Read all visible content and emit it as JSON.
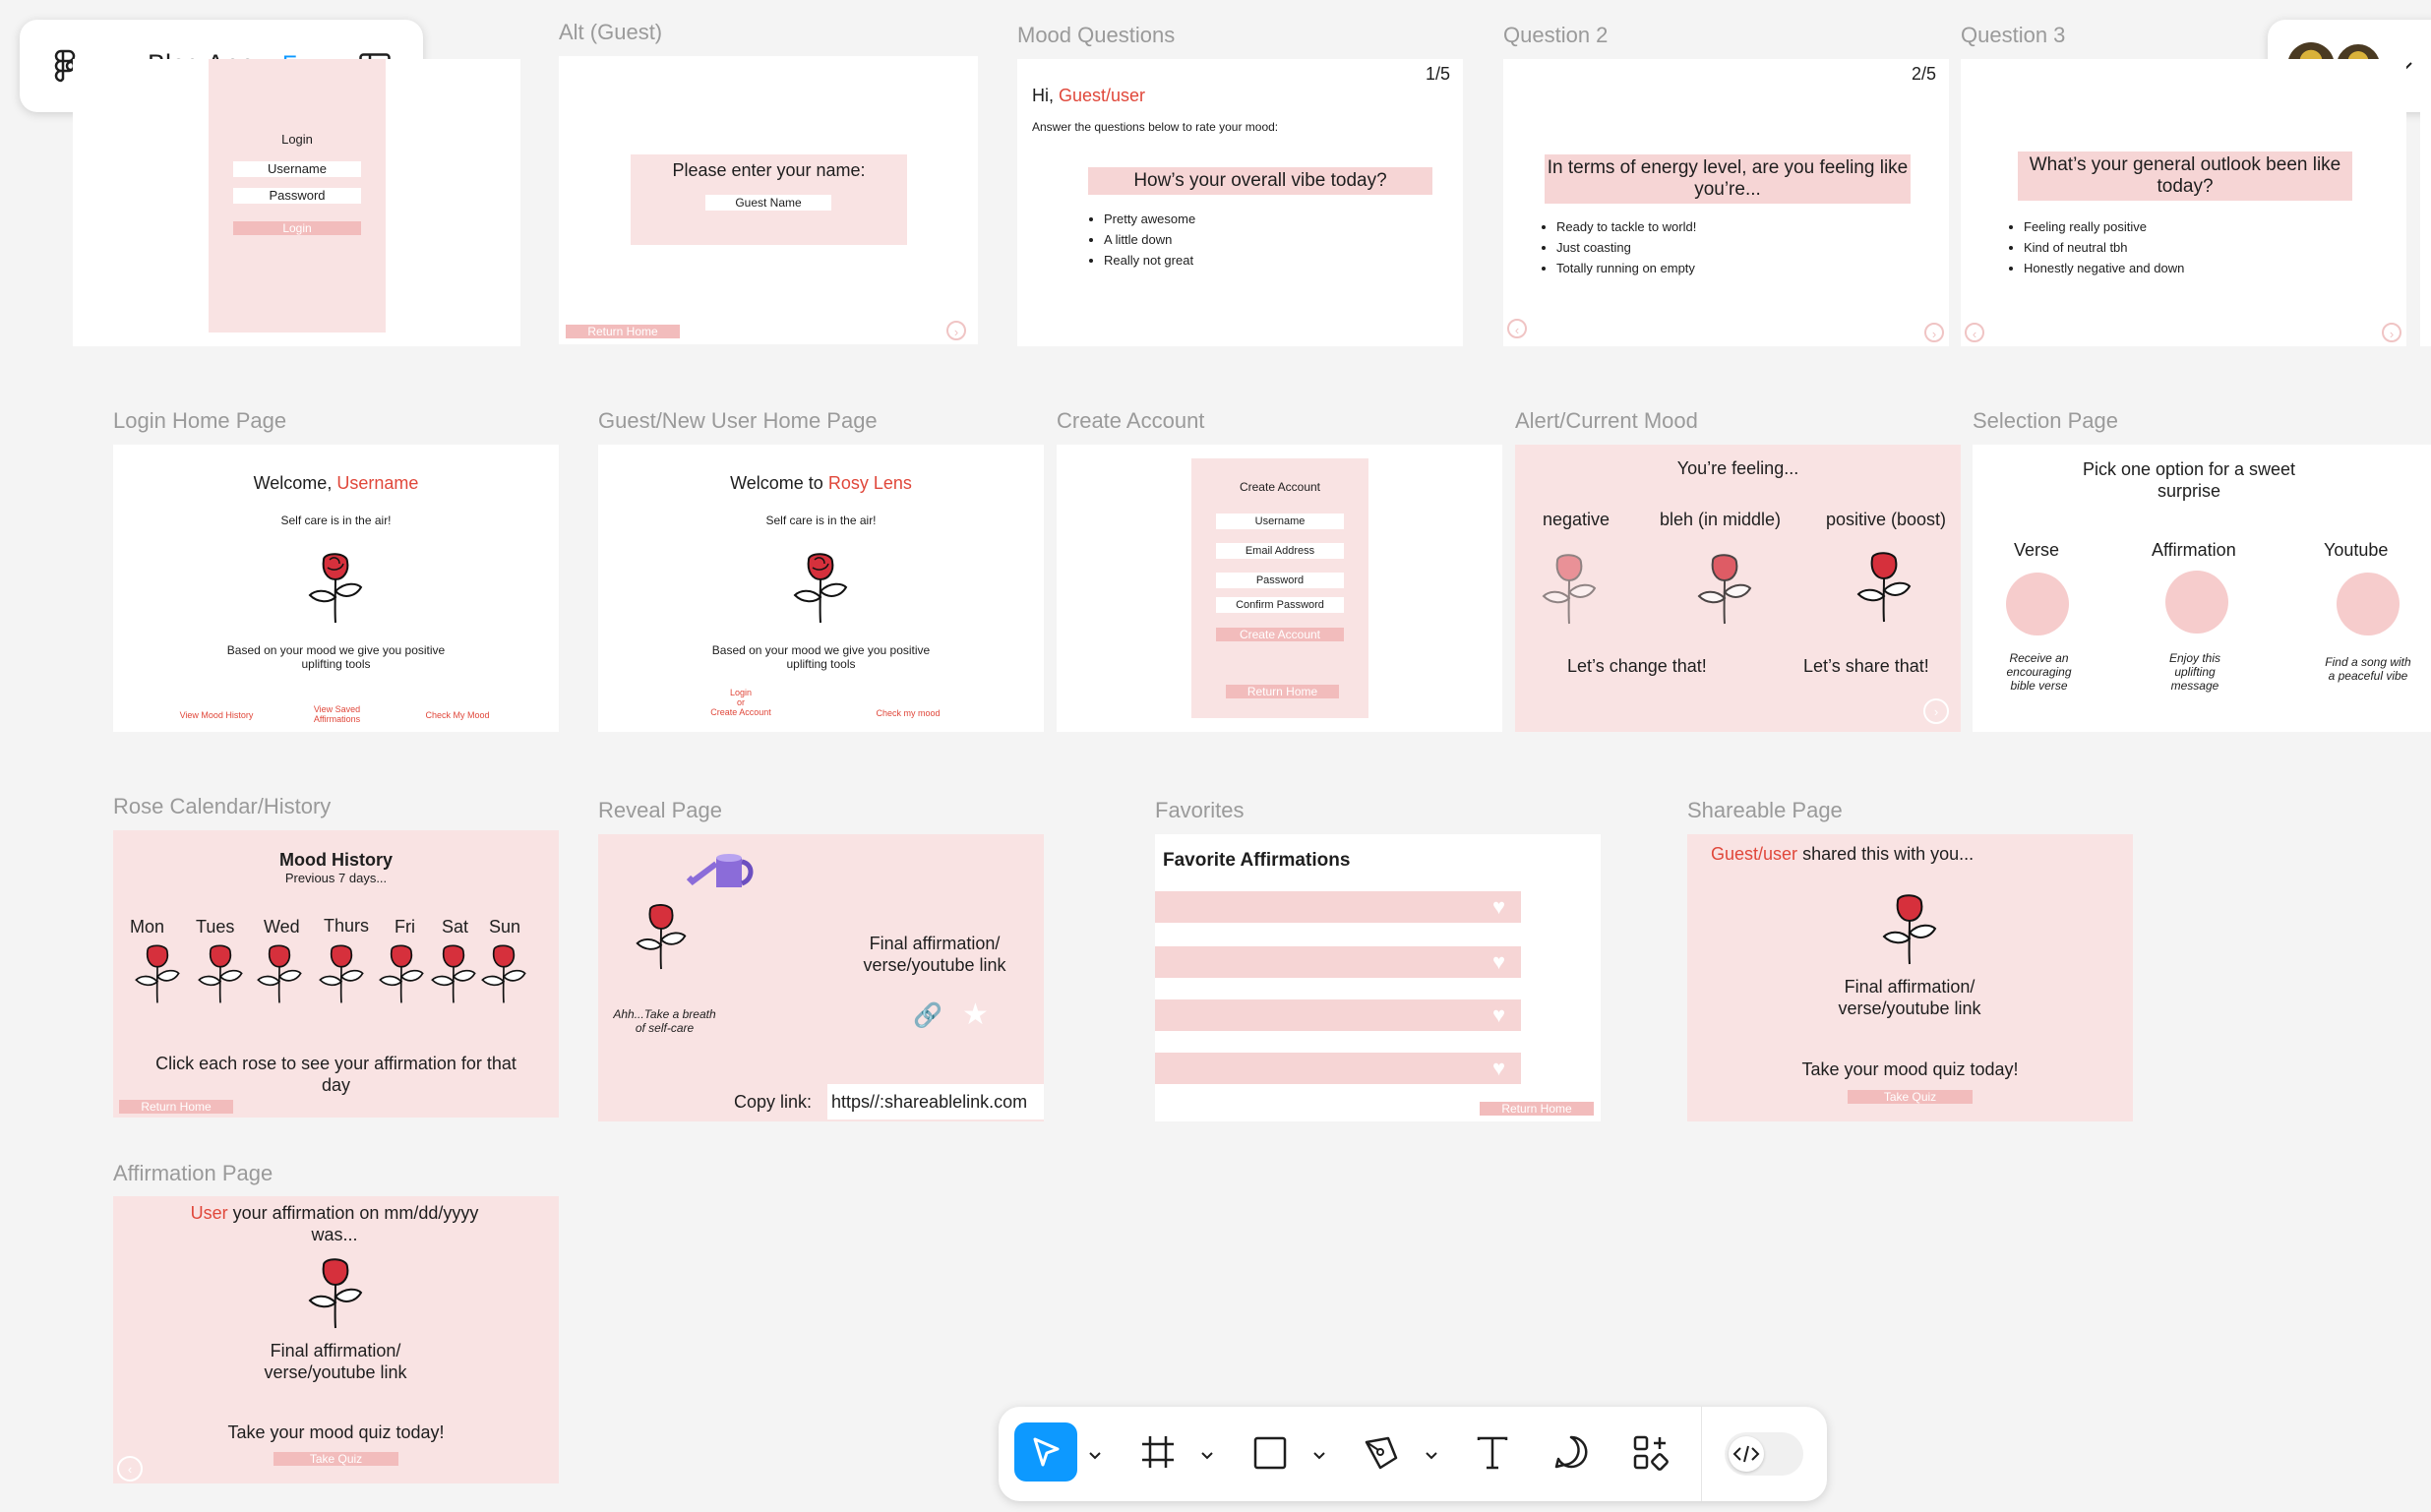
{
  "app": {
    "title": "Blog App",
    "plan": "Free"
  },
  "frames": {
    "alt_guest": {
      "label": "Alt (Guest)",
      "prompt": "Please enter your name:",
      "field": "Guest Name",
      "return": "Return Home"
    },
    "login": {
      "title": "Login",
      "username": "Username",
      "password": "Password",
      "button": "Login"
    },
    "mood_questions": {
      "label": "Mood Questions",
      "counter": "1/5",
      "greeting": "Hi,",
      "user": "Guest/user",
      "instruction": "Answer the questions below to rate your mood:",
      "question": "How’s your overall vibe today?",
      "options": [
        "Pretty awesome",
        "A little down",
        "Really not great"
      ]
    },
    "question2": {
      "label": "Question 2",
      "counter": "2/5",
      "question": "In terms of energy level, are you feeling like you’re...",
      "options": [
        "Ready to tackle to world!",
        "Just coasting",
        "Totally running on empty"
      ]
    },
    "question3": {
      "label": "Question 3",
      "question": "What’s your general outlook been like today?",
      "options": [
        "Feeling really positive",
        "Kind of neutral tbh",
        "Honestly negative and down"
      ]
    },
    "login_home": {
      "label": "Login Home Page",
      "welcome": "Welcome,",
      "user": "Username",
      "tagline": "Self care is in the air!",
      "desc": "Based on your mood we give you positive uplifting tools",
      "link1": "View Mood History",
      "link2": "View Saved Affirmations",
      "link3": "Check My Mood"
    },
    "guest_home": {
      "label": "Guest/New User Home Page",
      "welcome": "Welcome to",
      "brand": "Rosy Lens",
      "tagline": "Self care is in the air!",
      "desc": "Based on your mood we give you positive uplifting tools",
      "link1a": "Login",
      "link1b": "or",
      "link1c": "Create Account",
      "link2": "Check my mood"
    },
    "create_account": {
      "label": "Create Account",
      "title": "Create Account",
      "username": "Username",
      "email": "Email Address",
      "password": "Password",
      "confirm": "Confirm Password",
      "button": "Create Account",
      "return": "Return Home"
    },
    "alert": {
      "label": "Alert/Current Mood",
      "title": "You’re feeling...",
      "negative": "negative",
      "middle": "bleh (in middle)",
      "positive": "positive (boost)",
      "change": "Let’s change that!",
      "share": "Let’s share that!"
    },
    "selection": {
      "label": "Selection Page",
      "title": "Pick one option for a sweet surprise",
      "verse": "Verse",
      "affirmation": "Affirmation",
      "youtube": "Youtube",
      "verse_desc": "Receive an encouraging bible verse",
      "aff_desc": "Enjoy this uplifting message",
      "yt_desc": "Find a song with a peaceful vibe"
    },
    "calendar": {
      "label": "Rose Calendar/History",
      "title": "Mood History",
      "subtitle": "Previous 7 days...",
      "days": [
        "Mon",
        "Tues",
        "Wed",
        "Thurs",
        "Fri",
        "Sat",
        "Sun"
      ],
      "instruction": "Click each rose to see your affirmation for that day",
      "return": "Return Home"
    },
    "reveal": {
      "label": "Reveal Page",
      "breath": "Ahh...Take a breath of self-care",
      "final": "Final affirmation/ verse/youtube link",
      "copy": "Copy link:",
      "link": "https//:shareablelink.com"
    },
    "favorites": {
      "label": "Favorites",
      "title": "Favorite Affirmations",
      "return": "Return Home"
    },
    "shareable": {
      "label": "Shareable Page",
      "user": "Guest/user",
      "shared": "shared this with you...",
      "final": "Final affirmation/ verse/youtube link",
      "cta": "Take your mood quiz today!",
      "button": "Take Quiz"
    },
    "affirmation": {
      "label": "Affirmation Page",
      "user": "User",
      "text": "your affirmation on mm/dd/yyyy was...",
      "final": "Final affirmation/ verse/youtube link",
      "cta": "Take your mood quiz today!",
      "button": "Take Quiz"
    }
  },
  "toolbar": {
    "tools": [
      "move-tool",
      "frame-tool",
      "shape-tool",
      "pen-tool",
      "text-tool",
      "comment-tool",
      "actions-tool",
      "dev-mode-toggle"
    ]
  },
  "colors": {
    "accent": "#e0473a",
    "pink": "#f9e3e3",
    "brand_blue": "#0d99ff"
  }
}
